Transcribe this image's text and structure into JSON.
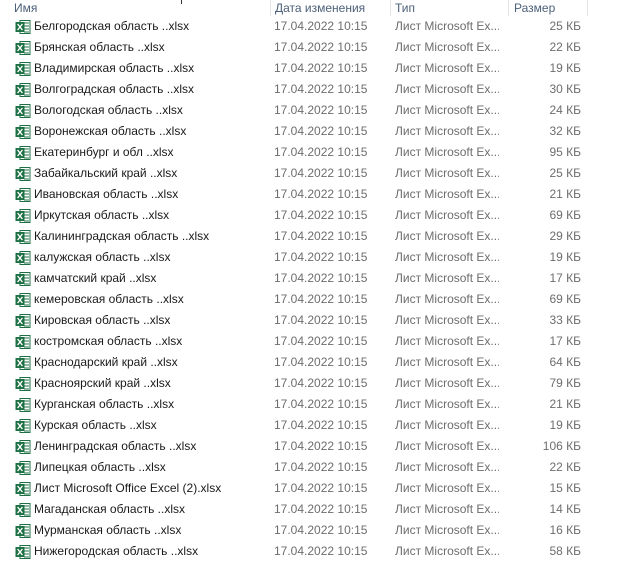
{
  "columns": {
    "name": "Имя",
    "date": "Дата изменения",
    "type": "Тип",
    "size": "Размер"
  },
  "colors": {
    "excel_green": "#1d7044",
    "header_text": "#4c607a",
    "secondary_text": "#6d6d6d"
  },
  "row_icon": "excel-file-icon",
  "files": [
    {
      "name": "Белгородская область ..xlsx",
      "date": "17.04.2022 10:15",
      "type": "Лист Microsoft Ex...",
      "size": "25 КБ"
    },
    {
      "name": "Брянская область ..xlsx",
      "date": "17.04.2022 10:15",
      "type": "Лист Microsoft Ex...",
      "size": "22 КБ"
    },
    {
      "name": "Владимирская область ..xlsx",
      "date": "17.04.2022 10:15",
      "type": "Лист Microsoft Ex...",
      "size": "19 КБ"
    },
    {
      "name": "Волгоградская область ..xlsx",
      "date": "17.04.2022 10:15",
      "type": "Лист Microsoft Ex...",
      "size": "30 КБ"
    },
    {
      "name": "Вологодская область ..xlsx",
      "date": "17.04.2022 10:15",
      "type": "Лист Microsoft Ex...",
      "size": "24 КБ"
    },
    {
      "name": "Воронежская область ..xlsx",
      "date": "17.04.2022 10:15",
      "type": "Лист Microsoft Ex...",
      "size": "32 КБ"
    },
    {
      "name": "Екатеринбург и обл ..xlsx",
      "date": "17.04.2022 10:15",
      "type": "Лист Microsoft Ex...",
      "size": "95 КБ"
    },
    {
      "name": "Забайкальский край ..xlsx",
      "date": "17.04.2022 10:15",
      "type": "Лист Microsoft Ex...",
      "size": "25 КБ"
    },
    {
      "name": "Ивановская область ..xlsx",
      "date": "17.04.2022 10:15",
      "type": "Лист Microsoft Ex...",
      "size": "21 КБ"
    },
    {
      "name": "Иркутская область ..xlsx",
      "date": "17.04.2022 10:15",
      "type": "Лист Microsoft Ex...",
      "size": "69 КБ"
    },
    {
      "name": "Калининградская область ..xlsx",
      "date": "17.04.2022 10:15",
      "type": "Лист Microsoft Ex...",
      "size": "29 КБ"
    },
    {
      "name": "калужская область ..xlsx",
      "date": "17.04.2022 10:15",
      "type": "Лист Microsoft Ex...",
      "size": "19 КБ"
    },
    {
      "name": "камчатский край ..xlsx",
      "date": "17.04.2022 10:15",
      "type": "Лист Microsoft Ex...",
      "size": "17 КБ"
    },
    {
      "name": "кемеровская область ..xlsx",
      "date": "17.04.2022 10:15",
      "type": "Лист Microsoft Ex...",
      "size": "69 КБ"
    },
    {
      "name": "Кировская область ..xlsx",
      "date": "17.04.2022 10:15",
      "type": "Лист Microsoft Ex...",
      "size": "33 КБ"
    },
    {
      "name": "костромская область ..xlsx",
      "date": "17.04.2022 10:15",
      "type": "Лист Microsoft Ex...",
      "size": "17 КБ"
    },
    {
      "name": "Краснодарский край ..xlsx",
      "date": "17.04.2022 10:15",
      "type": "Лист Microsoft Ex...",
      "size": "64 КБ"
    },
    {
      "name": "Красноярский край ..xlsx",
      "date": "17.04.2022 10:15",
      "type": "Лист Microsoft Ex...",
      "size": "79 КБ"
    },
    {
      "name": "Курганская область ..xlsx",
      "date": "17.04.2022 10:15",
      "type": "Лист Microsoft Ex...",
      "size": "21 КБ"
    },
    {
      "name": "Курская область ..xlsx",
      "date": "17.04.2022 10:15",
      "type": "Лист Microsoft Ex...",
      "size": "19 КБ"
    },
    {
      "name": "Ленинградская область ..xlsx",
      "date": "17.04.2022 10:15",
      "type": "Лист Microsoft Ex...",
      "size": "106 КБ"
    },
    {
      "name": "Липецкая область ..xlsx",
      "date": "17.04.2022 10:15",
      "type": "Лист Microsoft Ex...",
      "size": "22 КБ"
    },
    {
      "name": "Лист Microsoft Office Excel (2).xlsx",
      "date": "17.04.2022 10:15",
      "type": "Лист Microsoft Ex...",
      "size": "15 КБ"
    },
    {
      "name": "Магаданская область ..xlsx",
      "date": "17.04.2022 10:15",
      "type": "Лист Microsoft Ex...",
      "size": "14 КБ"
    },
    {
      "name": "Мурманская область ..xlsx",
      "date": "17.04.2022 10:15",
      "type": "Лист Microsoft Ex...",
      "size": "16 КБ"
    },
    {
      "name": "Нижегородская область ..xlsx",
      "date": "17.04.2022 10:15",
      "type": "Лист Microsoft Ex...",
      "size": "58 КБ"
    }
  ]
}
